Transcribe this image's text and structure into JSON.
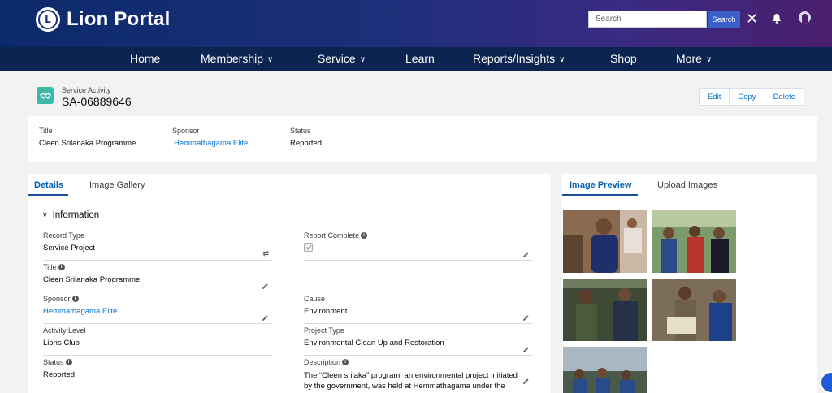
{
  "header": {
    "logo_text": "Lion Portal",
    "logo_mark": "L",
    "search_placeholder": "Search",
    "search_button": "Search",
    "close_glyph": "✕"
  },
  "nav": {
    "items": [
      {
        "label": "Home",
        "has_menu": false
      },
      {
        "label": "Membership",
        "has_menu": true
      },
      {
        "label": "Service",
        "has_menu": true
      },
      {
        "label": "Learn",
        "has_menu": false
      },
      {
        "label": "Reports/Insights",
        "has_menu": true
      },
      {
        "label": "Shop",
        "has_menu": false
      },
      {
        "label": "More",
        "has_menu": true
      }
    ]
  },
  "record": {
    "type": "Service Activity",
    "name": "SA-06889646",
    "actions": [
      "Edit",
      "Copy",
      "Delete"
    ]
  },
  "highlights": {
    "title_label": "Title",
    "title_value": "Cleen Srilanaka Programme",
    "sponsor_label": "Sponsor",
    "sponsor_value": "Hemmathagama Elite",
    "status_label": "Status",
    "status_value": "Reported"
  },
  "details": {
    "tabs": [
      "Details",
      "Image Gallery"
    ],
    "section_title": "Information",
    "fields": {
      "record_type_label": "Record Type",
      "record_type_value": "Service Project",
      "report_complete_label": "Report Complete",
      "report_complete_checked": true,
      "title_label": "Title",
      "title_value": "Cleen Srilanaka Programme",
      "sponsor_label": "Sponsor",
      "sponsor_value": "Hemmathagama Elite",
      "cause_label": "Cause",
      "cause_value": "Environment",
      "activity_level_label": "Activity Level",
      "activity_level_value": "Lions Club",
      "project_type_label": "Project Type",
      "project_type_value": "Environmental Clean Up and Restoration",
      "status_label": "Status",
      "status_value": "Reported",
      "description_label": "Description",
      "description_value": "The “Cleen srilaka” program, an environmental project initiated by the government, was held at Hemmathagama under the"
    }
  },
  "images": {
    "tabs": [
      "Image Preview",
      "Upload Images"
    ]
  },
  "colors": {
    "header_start": "#0b2a6b",
    "header_end": "#4a1f6e",
    "nav_bg": "#0c2550",
    "link": "#0070d2",
    "record_icon": "#3bb8a6"
  }
}
